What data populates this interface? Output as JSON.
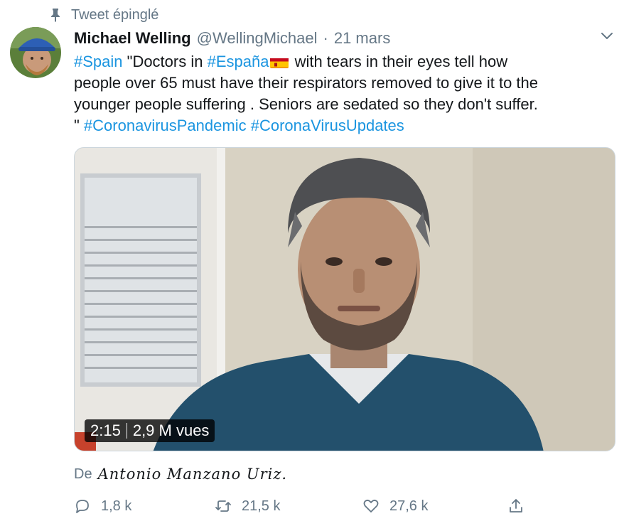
{
  "pinned_label": "Tweet épinglé",
  "author": {
    "display_name": "Michael Welling",
    "handle": "@WellingMichael",
    "separator": "·",
    "date": "21 mars"
  },
  "tweet": {
    "line1_tag": "#Spain",
    "line1_text": " \"Doctors in ",
    "line1_tag2": "#España",
    "line1_rest": " with tears in their eyes tell how",
    "line2": "people over 65 must have their respirators removed to give it to the",
    "line3": "younger people suffering . Seniors are sedated so they don't suffer.",
    "line4_prefix": "\" ",
    "tag3": "#CoronavirusPandemic",
    "tag4": "#CoronaVirusUpdates"
  },
  "media": {
    "duration": "2:15",
    "views": "2,9 M vues"
  },
  "credit": {
    "prefix": "De",
    "name": "Antonio Manzano Uriz."
  },
  "actions": {
    "replies": "1,8 k",
    "retweets": "21,5 k",
    "likes": "27,6 k"
  },
  "icons": [
    "pin-icon",
    "caret-down-icon",
    "spain-flag-icon",
    "reply-icon",
    "retweet-icon",
    "like-icon",
    "share-icon"
  ],
  "colors": {
    "link": "#1b95e0",
    "secondary_text": "#657786",
    "primary_text": "#14171a"
  }
}
